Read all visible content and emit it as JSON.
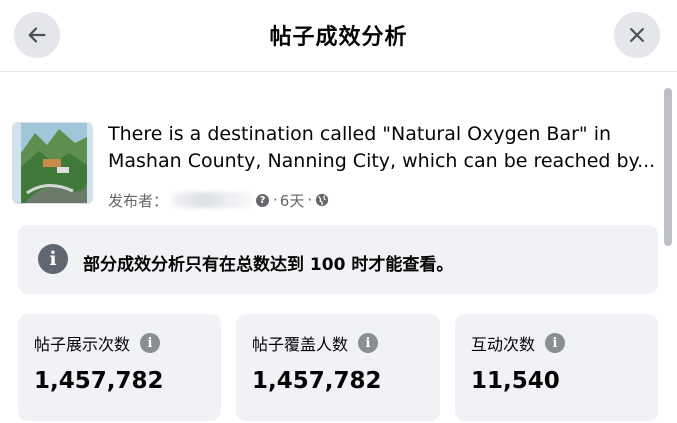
{
  "header": {
    "title": "帖子成效分析",
    "back_icon": "arrow-left-icon",
    "close_icon": "close-icon"
  },
  "post": {
    "thumbnail": "landscape-thumbnail",
    "text_line1": "There is a destination called \"Natural Oxygen Bar\" in",
    "text_line2": "Mashan County, Nanning City, which can be reached by...",
    "publisher_label": "发布者：",
    "time": "6天",
    "separator": "·",
    "audience_icon": "globe-icon"
  },
  "notice": {
    "icon": "info-icon",
    "text": "部分成效分析只有在总数达到 100 时才能查看。"
  },
  "stats": [
    {
      "label": "帖子展示次数",
      "value": "1,457,782",
      "icon": "info-icon"
    },
    {
      "label": "帖子覆盖人数",
      "value": "1,457,782",
      "icon": "info-icon"
    },
    {
      "label": "互动次数",
      "value": "11,540",
      "icon": "info-icon"
    }
  ],
  "colors": {
    "card_background": "#f0f2f5",
    "button_background": "#e4e6eb",
    "secondary_text": "#65676b"
  }
}
